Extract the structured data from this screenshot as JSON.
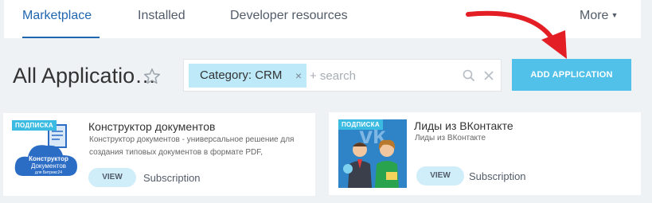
{
  "tabs": [
    {
      "label": "Marketplace",
      "active": true
    },
    {
      "label": "Installed",
      "active": false
    },
    {
      "label": "Developer resources",
      "active": false
    }
  ],
  "more": {
    "label": "More",
    "icon": "caret-down-icon"
  },
  "page_title": "All Applicatio…",
  "favorite_icon": "star-outline-icon",
  "filter": {
    "chip_label": "Category: CRM",
    "chip_close": "×",
    "search_placeholder": "+ search",
    "search_icon": "search-icon",
    "clear_icon": "close-icon"
  },
  "add_button": {
    "label": "ADD APPLICATION",
    "color": "#52c1e9"
  },
  "annotation": {
    "icon": "red-arrow-icon",
    "color": "#e31e24"
  },
  "apps": [
    {
      "badge": "ПОДПИСКА",
      "title": "Конструктор документов",
      "description": "Конструктор документов - универсальное решение для создания типовых документов в формате PDF,",
      "thumbnail_text": [
        "Конструктор",
        "Документов",
        "для Битрикс24"
      ],
      "view_label": "VIEW",
      "pricing": "Subscription"
    },
    {
      "badge": "ПОДПИСКА",
      "title": "Лиды из ВКонтакте",
      "description": "Лиды из ВКонтакте",
      "view_label": "VIEW",
      "pricing": "Subscription"
    }
  ],
  "colors": {
    "accent": "#2067b0",
    "badge": "#3bbbe1",
    "chip": "#bde9f8",
    "background": "#eef2f4"
  }
}
